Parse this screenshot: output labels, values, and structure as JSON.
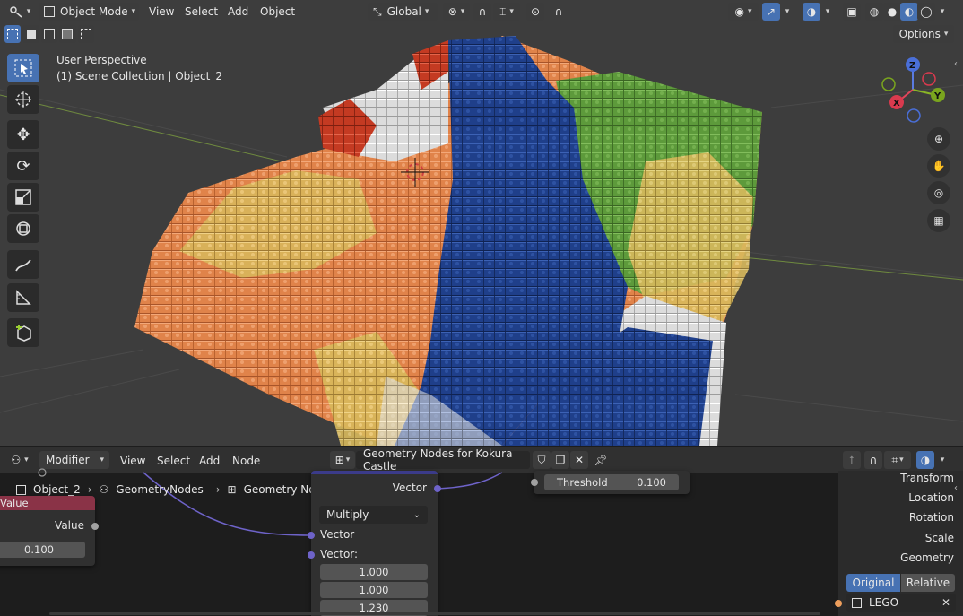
{
  "header": {
    "mode_label": "Object Mode",
    "menus": [
      "View",
      "Select",
      "Add",
      "Object"
    ],
    "orientation_label": "Global"
  },
  "viewport": {
    "info_line1": "User Perspective",
    "info_line2": "(1) Scene Collection | Object_2",
    "options_label": "Options",
    "axis_z": "Z",
    "axis_x": "X",
    "axis_y": "Y"
  },
  "node_header": {
    "editor_label": "Modifier",
    "menus": [
      "View",
      "Select",
      "Add",
      "Node"
    ],
    "tree_name": "Geometry Nodes for Kokura Castle"
  },
  "breadcrumb": {
    "object": "Object_2",
    "modifier": "GeometryNodes",
    "tree": "Geometry Nodes for Kokura Castle"
  },
  "value_node": {
    "title": "Value",
    "output_label": "Value",
    "value": "0.100"
  },
  "math_node": {
    "top_socket_label": "Vector",
    "operation": "Multiply",
    "input1_label": "Vector",
    "input2_label": "Vector:",
    "values": [
      "1.000",
      "1.000",
      "1.230"
    ]
  },
  "threshold_node": {
    "label": "Threshold",
    "value": "0.100"
  },
  "side_panel": {
    "rows": [
      "Transform",
      "Location",
      "Rotation",
      "Scale",
      "Geometry"
    ],
    "toggle_original": "Original",
    "toggle_relative": "Relative",
    "object_field": "LEGO"
  }
}
